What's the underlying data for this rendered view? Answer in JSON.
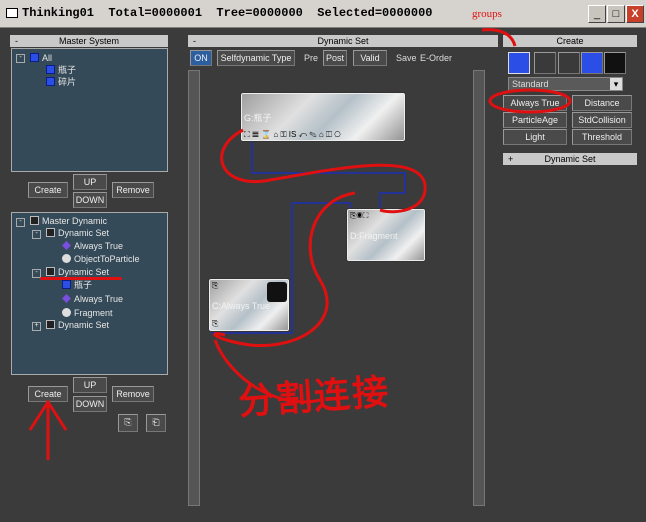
{
  "window": {
    "title": "Thinking01  Total=0000001  Tree=0000000  Selected=0000000",
    "minimize_symbol": "_",
    "maximize_symbol": "□",
    "close_symbol": "X"
  },
  "master_system": {
    "header": "Master System",
    "collapse_symbol": "-",
    "tree": [
      {
        "label": "All",
        "icon": "all-icon"
      },
      {
        "label": "瓶子",
        "icon": "event-icon"
      },
      {
        "label": "碎片",
        "icon": "event-icon"
      }
    ],
    "buttons": {
      "create": "Create",
      "up": "UP",
      "down": "DOWN",
      "remove": "Remove"
    }
  },
  "master_dynamic": {
    "tree": [
      {
        "label": "Master Dynamic"
      },
      {
        "label": "Dynamic Set"
      },
      {
        "label": "Always True"
      },
      {
        "label": "ObjectToParticle"
      },
      {
        "label": "Dynamic Set"
      },
      {
        "label": "瓶子"
      },
      {
        "label": "Always True"
      },
      {
        "label": "Fragment"
      },
      {
        "label": "Dynamic Set"
      }
    ],
    "buttons": {
      "create": "Create",
      "up": "UP",
      "down": "DOWN",
      "remove": "Remove"
    }
  },
  "dynamic_set": {
    "header": "Dynamic Set",
    "collapse_symbol": "-",
    "toolbar": {
      "on": "ON",
      "type": "Selfdynamic Type",
      "pre": "Pre",
      "post": "Post",
      "valid": "Valid",
      "save": "Save",
      "eorder": "E-Order"
    },
    "nodes": {
      "g_bottle": "G:瓶子",
      "fragment": "D:Fragment",
      "always_true": "C:Always True"
    },
    "g_icons": "⛶ 𝌆 ⌛ ⌂ ⚿ IS ⤺ ✎ ⌂ ◫ ⎔"
  },
  "create_panel": {
    "header": "Create",
    "dropdown_value": "Standard",
    "buttons": [
      "Always True",
      "Distance",
      "ParticleAge",
      "StdCollision",
      "Light",
      "Threshold"
    ],
    "rollout": "Dynamic Set",
    "rollout_symbol": "+"
  },
  "annotations": {
    "groups_label": "groups",
    "handwritten_note": "分割连接"
  },
  "colors": {
    "annotation_red": "#e01010",
    "wire_blue": "#1a2fb8",
    "tree_bg": "#344a58"
  }
}
